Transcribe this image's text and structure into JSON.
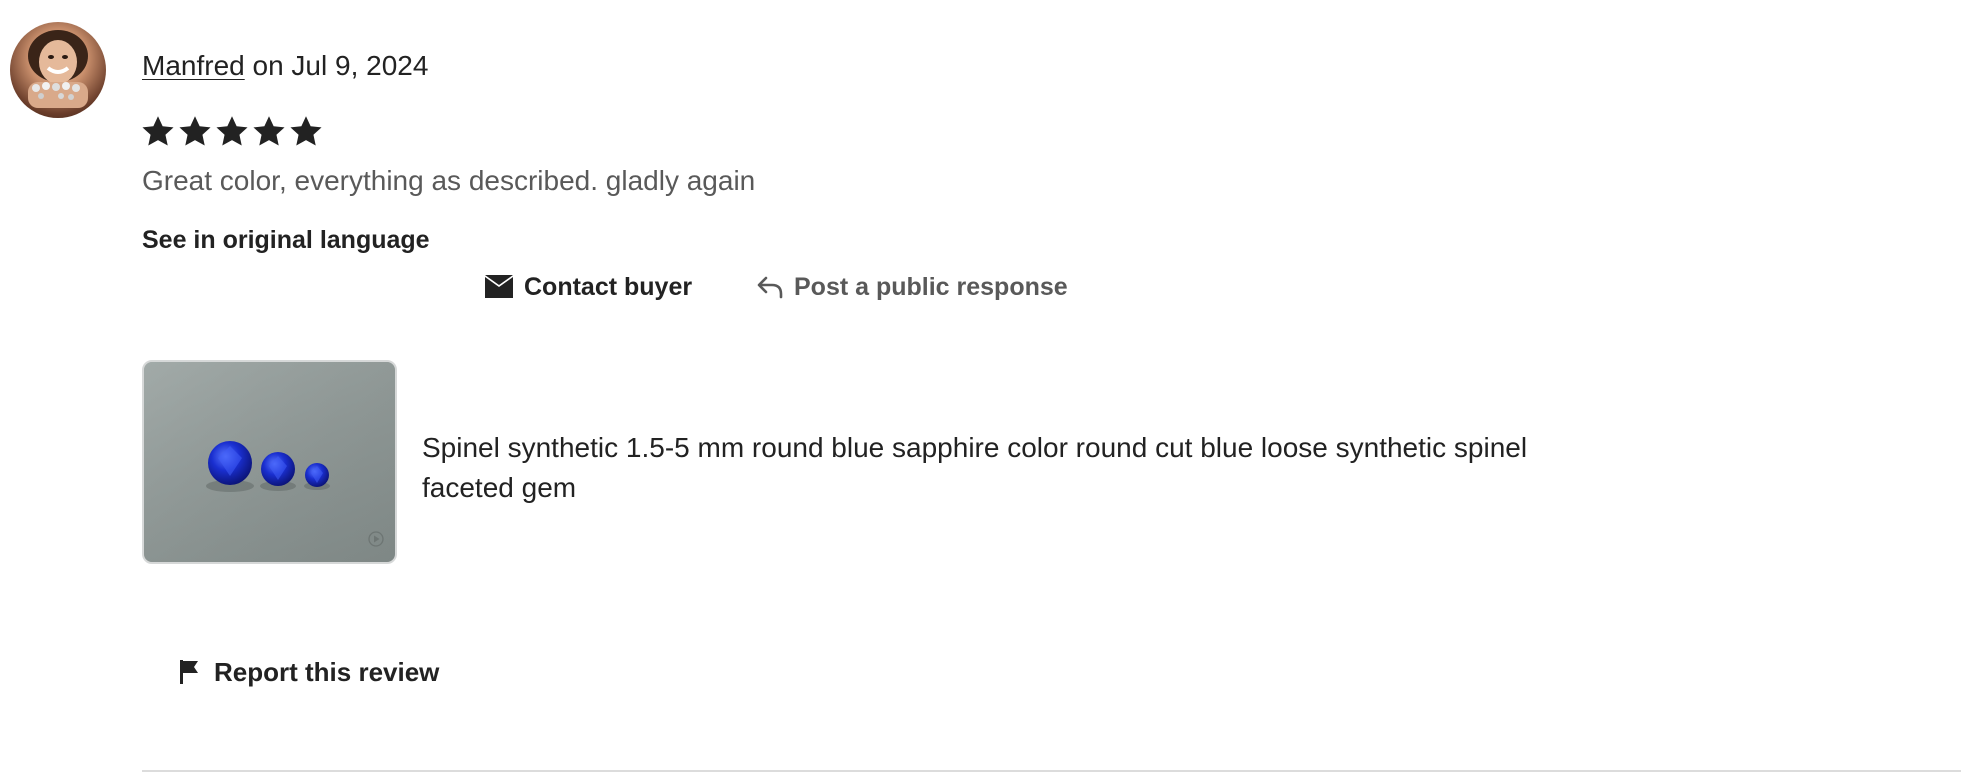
{
  "review": {
    "reviewer_name": "Manfred",
    "date_text": " on Jul 9, 2024",
    "rating": 5,
    "rating_max": 5,
    "text": "Great color, everything as described. gladly again",
    "see_original_label": "See in original language"
  },
  "actions": {
    "contact_buyer_label": "Contact buyer",
    "post_response_label": "Post a public response"
  },
  "product": {
    "title": "Spinel synthetic 1.5-5 mm round blue sapphire color round cut blue loose synthetic spinel faceted gem"
  },
  "footer": {
    "report_label": "Report this review"
  },
  "icons": {
    "star": "star-icon",
    "contact": "envelope-icon",
    "reply": "reply-arrow-icon",
    "report": "flag-icon"
  },
  "colors": {
    "text_primary": "#222222",
    "text_secondary": "#595959",
    "divider": "#dcdcdc",
    "gem_blue": "#1a2fd0"
  }
}
